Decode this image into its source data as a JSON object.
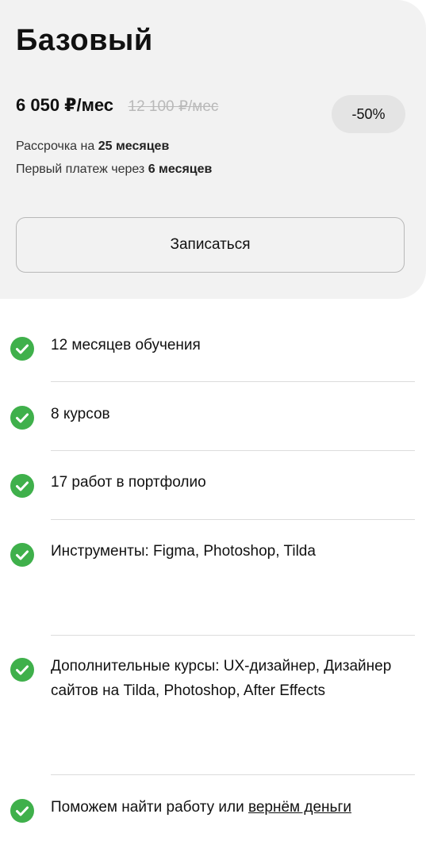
{
  "plan": {
    "title": "Базовый",
    "price_current": "6 050 ₽/мес",
    "price_old": "12 100 ₽/мес",
    "discount": "-50%",
    "installment_prefix": "Рассрочка на ",
    "installment_value": "25 месяцев",
    "first_payment_prefix": "Первый платеж через ",
    "first_payment_value": "6 месяцев",
    "enroll_label": "Записаться"
  },
  "features": [
    {
      "icon": "check-circle-icon",
      "text": "12 месяцев обучения"
    },
    {
      "icon": "check-circle-icon",
      "text": "8 курсов"
    },
    {
      "icon": "check-circle-icon",
      "text": "17 работ в портфолио"
    },
    {
      "icon": "check-circle-icon",
      "text": "Инструменты: Figma, Photoshop, Tilda"
    },
    {
      "icon": "check-circle-icon",
      "text": "Дополнительные курсы: UX-дизайнер, Дизайнер сайтов на Tilda, Photoshop, After Effects"
    },
    {
      "icon": "check-circle-icon",
      "text_prefix": "Поможем найти работу или ",
      "link_text": "вернём деньги"
    }
  ],
  "colors": {
    "card_background": "#f2f2f2",
    "check_green": "#3fb04b",
    "badge_background": "#e4e4e4",
    "old_price": "#b9b9b9"
  }
}
